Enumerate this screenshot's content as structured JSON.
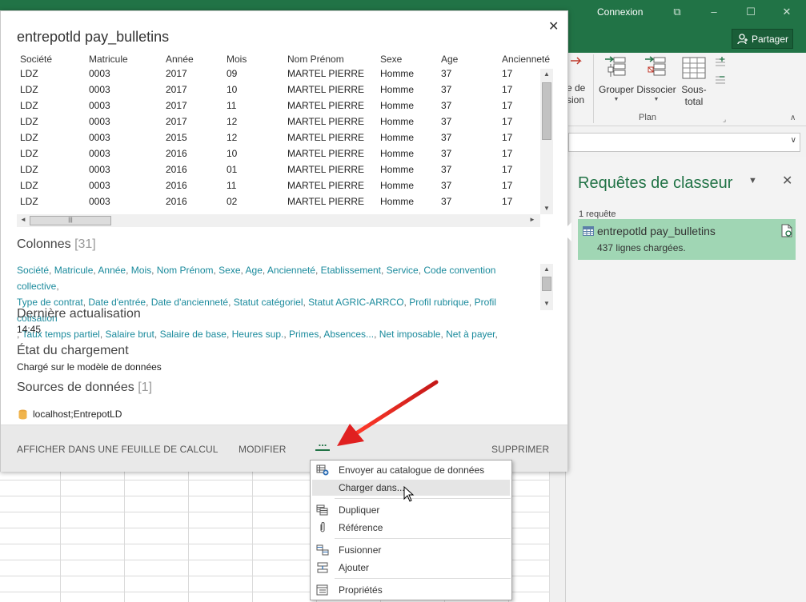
{
  "titlebar": {
    "connexion": "Connexion"
  },
  "share": {
    "label": "Partager"
  },
  "ribbon": {
    "partial_label_1": "e de",
    "partial_label_2": "sion",
    "grouper": "Grouper",
    "dissocier": "Dissocier",
    "sous_total_1": "Sous-",
    "sous_total_2": "total",
    "group_label": "Plan"
  },
  "queries_pane": {
    "title": "Requêtes de classeur",
    "count": "1 requête",
    "query": {
      "name": "entrepotld pay_bulletins",
      "status": "437 lignes chargées."
    }
  },
  "popup": {
    "title": "entrepotld pay_bulletins",
    "preview": {
      "headers": [
        "Société",
        "Matricule",
        "Année",
        "Mois",
        "Nom Prénom",
        "Sexe",
        "Age",
        "Ancienneté"
      ],
      "rows": [
        [
          "LDZ",
          "0003",
          "2017",
          "09",
          "MARTEL PIERRE",
          "Homme",
          "37",
          "17"
        ],
        [
          "LDZ",
          "0003",
          "2017",
          "10",
          "MARTEL PIERRE",
          "Homme",
          "37",
          "17"
        ],
        [
          "LDZ",
          "0003",
          "2017",
          "11",
          "MARTEL PIERRE",
          "Homme",
          "37",
          "17"
        ],
        [
          "LDZ",
          "0003",
          "2017",
          "12",
          "MARTEL PIERRE",
          "Homme",
          "37",
          "17"
        ],
        [
          "LDZ",
          "0003",
          "2015",
          "12",
          "MARTEL PIERRE",
          "Homme",
          "37",
          "17"
        ],
        [
          "LDZ",
          "0003",
          "2016",
          "10",
          "MARTEL PIERRE",
          "Homme",
          "37",
          "17"
        ],
        [
          "LDZ",
          "0003",
          "2016",
          "01",
          "MARTEL PIERRE",
          "Homme",
          "37",
          "17"
        ],
        [
          "LDZ",
          "0003",
          "2016",
          "11",
          "MARTEL PIERRE",
          "Homme",
          "37",
          "17"
        ],
        [
          "LDZ",
          "0003",
          "2016",
          "02",
          "MARTEL PIERRE",
          "Homme",
          "37",
          "17"
        ]
      ]
    },
    "columns": {
      "title": "Colonnes",
      "count": "[31]",
      "line1": [
        "Société",
        "Matricule",
        "Année",
        "Mois",
        "Nom Prénom",
        "Sexe",
        "Age",
        "Ancienneté",
        "Etablissement",
        "Service",
        "Code convention collective"
      ],
      "line2": [
        "Type de contrat",
        "Date d'entrée",
        "Date d'ancienneté",
        "Statut catégoriel",
        "Statut AGRIC-ARRCO",
        "Profil rubrique",
        "Profil cotisation"
      ],
      "line3": [
        "Taux temps partiel",
        "Salaire brut",
        "Salaire de base",
        "Heures sup.",
        "Primes",
        "Absences...",
        "Net imposable",
        "Net à payer"
      ]
    },
    "last_refresh": {
      "title": "Dernière actualisation",
      "value": "14:45"
    },
    "load_state": {
      "title": "État du chargement",
      "value": "Chargé sur le modèle de données"
    },
    "sources": {
      "title": "Sources de données",
      "count": "[1]",
      "value": "localhost;EntrepotLD"
    },
    "footer": {
      "show_in_sheet": "AFFICHER DANS UNE FEUILLE DE CALCUL",
      "modify": "MODIFIER",
      "more": "...",
      "delete": "SUPPRIMER"
    }
  },
  "context_menu": {
    "items": [
      {
        "label": "Envoyer au catalogue de données",
        "icon": "catalog-icon"
      },
      {
        "label": "Charger dans...",
        "icon": ""
      },
      {
        "label": "Dupliquer",
        "icon": "duplicate-icon"
      },
      {
        "label": "Référence",
        "icon": "paperclip-icon"
      },
      {
        "label": "Fusionner",
        "icon": "merge-icon"
      },
      {
        "label": "Ajouter",
        "icon": "append-icon"
      },
      {
        "label": "Propriétés",
        "icon": "properties-icon"
      }
    ],
    "hovered": "Charger dans..."
  },
  "colors": {
    "excel_green": "#217346",
    "card_green": "#a0d6b4",
    "link_teal": "#1a8a9c",
    "arrow_red": "#e02020"
  }
}
